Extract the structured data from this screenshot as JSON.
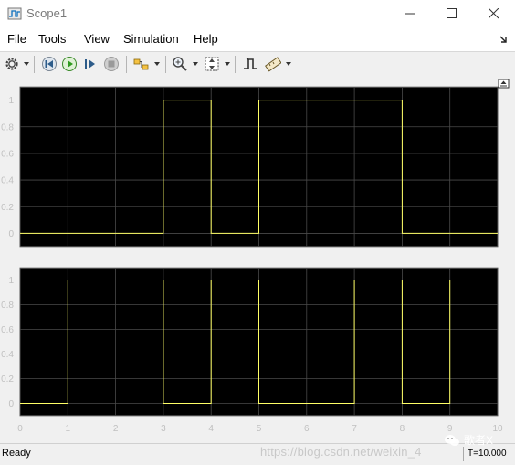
{
  "window": {
    "title": "Scope1",
    "icon": "matlab-scope-icon"
  },
  "menubar": {
    "items": [
      "File",
      "Tools",
      "View",
      "Simulation",
      "Help"
    ],
    "dock_icon": "dock-arrow-icon"
  },
  "toolbar": {
    "buttons": [
      {
        "name": "settings",
        "icon": "gear-icon",
        "dropdown": true
      },
      {
        "name": "step-back",
        "icon": "step-back-icon"
      },
      {
        "name": "run",
        "icon": "run-icon"
      },
      {
        "name": "step-forward",
        "icon": "step-forward-icon"
      },
      {
        "name": "stop",
        "icon": "stop-icon"
      },
      {
        "name": "highlight-block",
        "icon": "highlight-block-icon",
        "dropdown": true
      },
      {
        "name": "zoom",
        "icon": "zoom-icon",
        "dropdown": true
      },
      {
        "name": "autoscale",
        "icon": "autoscale-icon",
        "dropdown": true
      },
      {
        "name": "trigger",
        "icon": "trigger-icon"
      },
      {
        "name": "measurements",
        "icon": "measurements-icon",
        "dropdown": true
      }
    ]
  },
  "chart_data": [
    {
      "type": "line",
      "step": true,
      "x": [
        0,
        1,
        2,
        3,
        4,
        5,
        6,
        7,
        8,
        9,
        10
      ],
      "series": [
        {
          "values": [
            0,
            0,
            0,
            1,
            0,
            1,
            1,
            1,
            0,
            0,
            0
          ],
          "color": "#ffff66"
        }
      ],
      "xlim": [
        0,
        10
      ],
      "ylim": [
        -0.1,
        1.1
      ],
      "yticks": [
        "0",
        "0.2",
        "0.4",
        "0.6",
        "0.8",
        "1"
      ],
      "xticklabels_visible": false,
      "grid": true,
      "background": "#000000"
    },
    {
      "type": "line",
      "step": true,
      "x": [
        0,
        1,
        2,
        3,
        4,
        5,
        6,
        7,
        8,
        9,
        10
      ],
      "series": [
        {
          "values": [
            0,
            1,
            1,
            0,
            1,
            0,
            0,
            1,
            0,
            1,
            1
          ],
          "color": "#ffff66"
        }
      ],
      "xlim": [
        0,
        10
      ],
      "ylim": [
        -0.1,
        1.1
      ],
      "yticks": [
        "0",
        "0.2",
        "0.4",
        "0.6",
        "0.8",
        "1"
      ],
      "xticks": [
        "0",
        "1",
        "2",
        "3",
        "4",
        "5",
        "6",
        "7",
        "8",
        "9",
        "10"
      ],
      "grid": true,
      "background": "#000000"
    }
  ],
  "statusbar": {
    "status": "Ready",
    "time": "T=10.000"
  },
  "watermark": {
    "url": "https://blog.csdn.net/weixin_4",
    "brand": "歌者X"
  },
  "colors": {
    "plot_bg": "#000000",
    "frame_bg": "#f0f0f0",
    "grid": "#4a4a4a",
    "axis_text": "#c0c0c0",
    "signal": "#ffff66"
  }
}
